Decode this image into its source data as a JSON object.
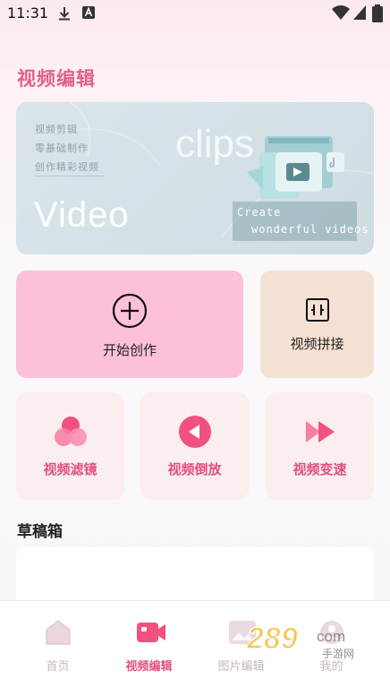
{
  "status_bar": {
    "time": "11:31"
  },
  "page_title": "视频编辑",
  "banner": {
    "tags": [
      "视频剪辑",
      "零基础制作",
      "创作精彩视频"
    ],
    "big_text": "Video",
    "clips_text": "clips",
    "create_line1": "Create",
    "create_line2": "wonderful videos"
  },
  "actions": {
    "start_label": "开始创作",
    "merge_label": "视频拼接"
  },
  "tools": [
    {
      "label": "视频滤镜",
      "icon": "filter-icon"
    },
    {
      "label": "视频倒放",
      "icon": "reverse-icon"
    },
    {
      "label": "视频变速",
      "icon": "speed-icon"
    }
  ],
  "drafts_title": "草稿箱",
  "tabs": [
    {
      "label": "首页",
      "icon": "home-icon",
      "active": false
    },
    {
      "label": "视频编辑",
      "icon": "video-edit-icon",
      "active": true
    },
    {
      "label": "图片编辑",
      "icon": "image-edit-icon",
      "active": false
    },
    {
      "label": "我的",
      "icon": "profile-icon",
      "active": false
    }
  ],
  "watermark": {
    "text": "289",
    "suffix": "com",
    "sub": "手游网"
  },
  "colors": {
    "accent": "#e24f80",
    "title": "#e35f8c",
    "start_card": "#fcc0da",
    "merge_card": "#f5e1d3",
    "tool_card": "#fbeeee"
  }
}
